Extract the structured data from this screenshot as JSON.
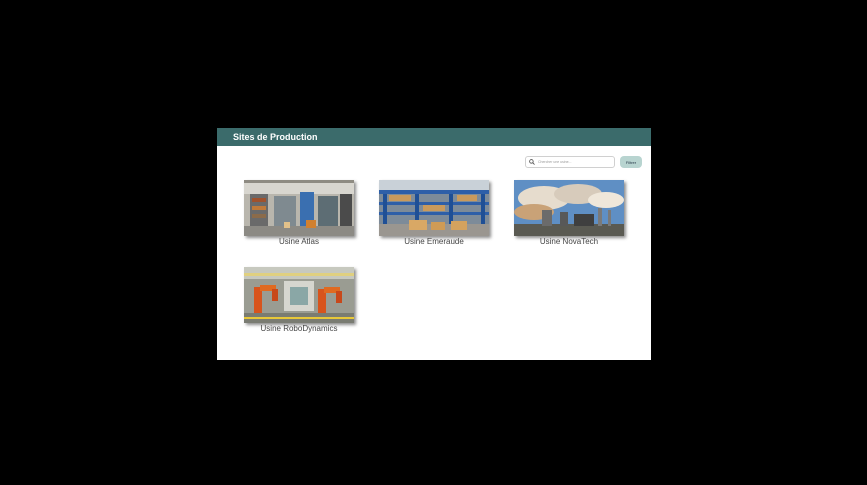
{
  "header": {
    "title": "Sites de Production"
  },
  "search": {
    "placeholder": "Chercher une usine...",
    "value": "",
    "icon": "search-icon"
  },
  "filter": {
    "label": "Filtrer"
  },
  "colors": {
    "header_bg": "#3b6b6b",
    "filter_bg": "#b8d4d0"
  },
  "sites": [
    {
      "name": "Usine Atlas",
      "image": "warehouse-interior"
    },
    {
      "name": "Usine Emeraude",
      "image": "warehouse-blue-racks"
    },
    {
      "name": "Usine NovaTech",
      "image": "power-plant"
    },
    {
      "name": "Usine RoboDynamics",
      "image": "robot-assembly-line"
    }
  ]
}
